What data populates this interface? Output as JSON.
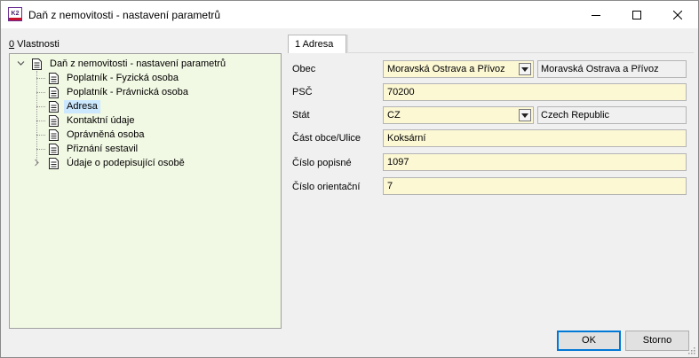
{
  "window": {
    "title": "Daň z nemovitosti - nastavení parametrů",
    "app_icon_text": "K2",
    "controls": {
      "minimize": "minimize-icon",
      "maximize": "maximize-icon",
      "close": "close-icon"
    }
  },
  "properties": {
    "label_hotkey": "0",
    "label_rest": " Vlastnosti"
  },
  "tree": {
    "root": {
      "label": "Daň z nemovitosti - nastavení parametrů",
      "expanded": true
    },
    "items": [
      {
        "label": "Poplatník - Fyzická osoba",
        "selected": false,
        "has_children": false
      },
      {
        "label": "Poplatník - Právnická osoba",
        "selected": false,
        "has_children": false
      },
      {
        "label": "Adresa",
        "selected": true,
        "has_children": false
      },
      {
        "label": "Kontaktní údaje",
        "selected": false,
        "has_children": false
      },
      {
        "label": "Oprávněná osoba",
        "selected": false,
        "has_children": false
      },
      {
        "label": "Přiznání sestavil",
        "selected": false,
        "has_children": false
      },
      {
        "label": "Údaje o podepisující osobě",
        "selected": false,
        "has_children": true
      }
    ]
  },
  "tabs": [
    {
      "label": "1 Adresa",
      "active": true
    }
  ],
  "form": {
    "obec": {
      "label": "Obec",
      "value": "Moravská Ostrava a Přívoz",
      "display": "Moravská Ostrava a Přívoz"
    },
    "psc": {
      "label": "PSČ",
      "value": "70200"
    },
    "stat": {
      "label": "Stát",
      "value": "CZ",
      "display": "Czech Republic"
    },
    "cast_obce": {
      "label": "Část obce/Ulice",
      "value": "Koksární"
    },
    "cislo_popisne": {
      "label": "Číslo popisné",
      "value": "1097"
    },
    "cislo_orientacni": {
      "label": "Číslo orientační",
      "value": "7"
    }
  },
  "buttons": {
    "ok": "OK",
    "cancel": "Storno"
  },
  "colors": {
    "tree_bg": "#f1f8e3",
    "field_bg": "#fcf8d4",
    "selection": "#cce8ff",
    "default_button_border": "#0078d7"
  }
}
